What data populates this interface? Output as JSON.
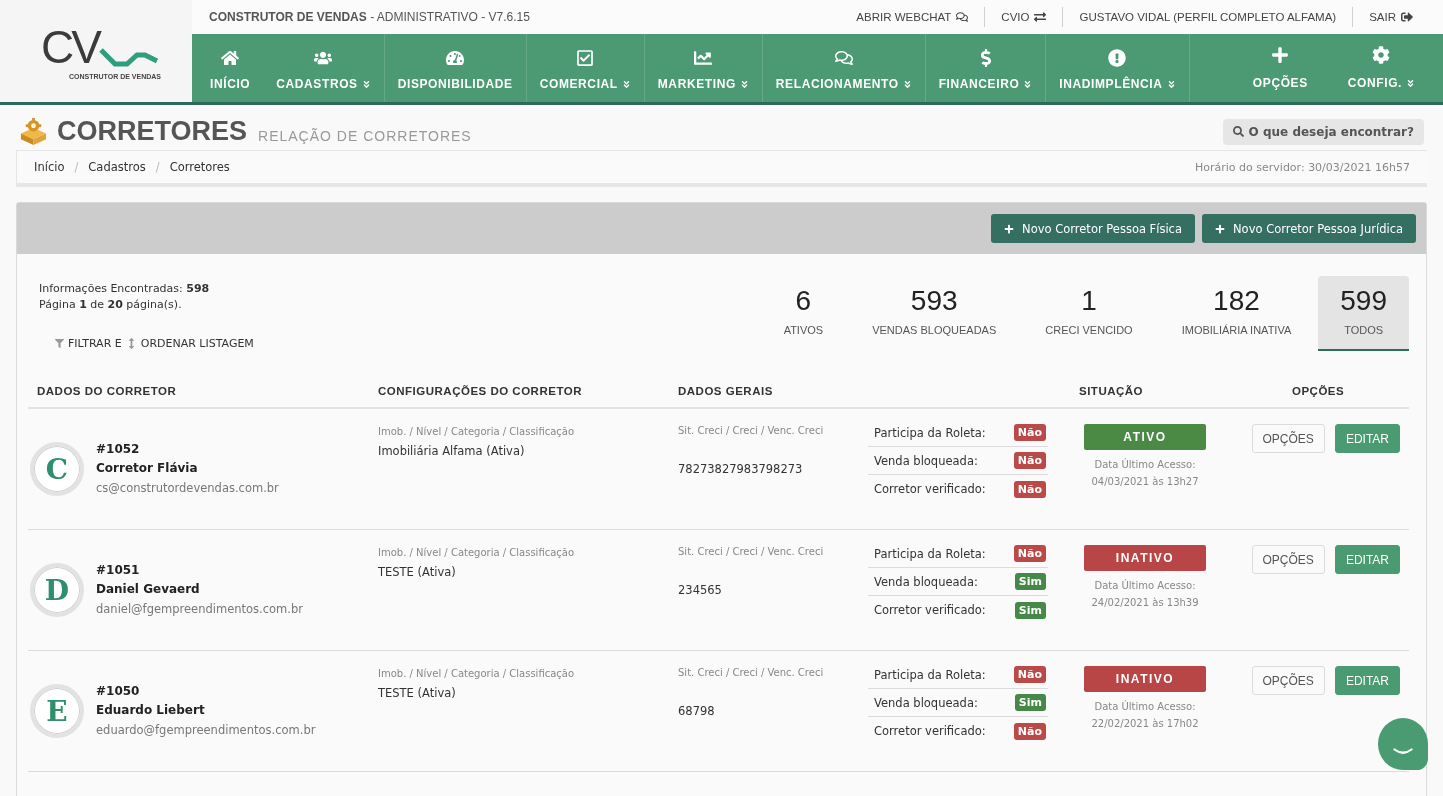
{
  "header": {
    "logo": {
      "letters": "CV",
      "caption": "CONSTRUTOR DE VENDAS"
    },
    "app_title": "**CONSTRUTOR DE VENDAS** - ADMINISTRATIVO - V7.6.15",
    "top_links": [
      "ABRIR WEBCHAT",
      "CVIO",
      "GUSTAVO VIDAL (PERFIL COMPLETO ALFAMA)",
      "SAIR"
    ]
  },
  "nav": {
    "items": [
      {
        "label": "INÍCIO",
        "has_menu": false
      },
      {
        "label": "CADASTROS",
        "has_menu": true
      },
      {
        "label": "DISPONIBILIDADE",
        "has_menu": false
      },
      {
        "label": "COMERCIAL",
        "has_menu": true
      },
      {
        "label": "MARKETING",
        "has_menu": true
      },
      {
        "label": "RELACIONAMENTO",
        "has_menu": true
      },
      {
        "label": "FINANCEIRO",
        "has_menu": true
      },
      {
        "label": "INADIMPLÊNCIA",
        "has_menu": true
      }
    ],
    "right_items": [
      {
        "label": "OPÇÕES",
        "has_menu": false
      },
      {
        "label": "CONFIG.",
        "has_menu": true
      }
    ]
  },
  "page": {
    "title": "CORRETORES",
    "subtitle": "RELAÇÃO DE CORRETORES",
    "search_button": "O que deseja encontrar?"
  },
  "breadcrumb": {
    "items": [
      "Início",
      "Cadastros",
      "Corretores"
    ],
    "separator": "/",
    "server_time": "Horário do servidor: 30/03/2021 16h57"
  },
  "panel": {
    "buttons": [
      "Novo Corretor Pessoa Física",
      "Novo Corretor Pessoa Jurídica"
    ],
    "info": [
      "Informações Encontradas: **598**",
      "Página **1** de **20** página(s)."
    ],
    "filter": {
      "filter_label": "FILTRAR E",
      "sort_label": "ORDENAR LISTAGEM"
    }
  },
  "stats": [
    {
      "value": "6",
      "label": "ATIVOS",
      "selected": false
    },
    {
      "value": "593",
      "label": "VENDAS BLOQUEADAS",
      "selected": false
    },
    {
      "value": "1",
      "label": "CRECI VENCIDO",
      "selected": false
    },
    {
      "value": "182",
      "label": "IMOBILIÁRIA INATIVA",
      "selected": false
    },
    {
      "value": "599",
      "label": "TODOS",
      "selected": true
    }
  ],
  "table": {
    "columns": [
      "DADOS DO CORRETOR",
      "CONFIGURAÇÕES DO CORRETOR",
      "DADOS GERAIS",
      "SITUAÇÃO",
      "OPÇÕES"
    ],
    "rows": [
      {
        "initial": "C",
        "id": "#1052",
        "name": "Corretor Flávia",
        "email": "cs@construtordevendas.com.br",
        "config_label": "Imob. / Nível / Categoria / Classificação",
        "config_value": "Imobiliária Alfama (Ativa)",
        "general_label": "Sit. Creci / Creci / Venc. Creci",
        "general_value": "78273827983798273",
        "flags": [
          {
            "label": "Participa da Roleta:",
            "value": "Não",
            "on": false
          },
          {
            "label": "Venda bloqueada:",
            "value": "Não",
            "on": false
          },
          {
            "label": "Corretor verificado:",
            "value": "Não",
            "on": false
          }
        ],
        "status": {
          "label": "ATIVO",
          "active": true
        },
        "last_access_label": "Data Último Acesso:",
        "last_access": "04/03/2021 às 13h27",
        "buttons": [
          {
            "label": "OPÇÕES",
            "kind": "default"
          },
          {
            "label": "EDITAR",
            "kind": "primary"
          }
        ]
      },
      {
        "initial": "D",
        "id": "#1051",
        "name": "Daniel Gevaerd",
        "email": "daniel@fgempreendimentos.com.br",
        "config_label": "Imob. / Nível / Categoria / Classificação",
        "config_value": "TESTE (Ativa)",
        "general_label": "Sit. Creci / Creci / Venc. Creci",
        "general_value": "234565",
        "flags": [
          {
            "label": "Participa da Roleta:",
            "value": "Não",
            "on": false
          },
          {
            "label": "Venda bloqueada:",
            "value": "Sim",
            "on": true
          },
          {
            "label": "Corretor verificado:",
            "value": "Sim",
            "on": true
          }
        ],
        "status": {
          "label": "INATIVO",
          "active": false
        },
        "last_access_label": "Data Último Acesso:",
        "last_access": "24/02/2021 às 13h39",
        "buttons": [
          {
            "label": "OPÇÕES",
            "kind": "default"
          },
          {
            "label": "EDITAR",
            "kind": "primary"
          }
        ]
      },
      {
        "initial": "E",
        "id": "#1050",
        "name": "Eduardo Liebert",
        "email": "eduardo@fgempreendimentos.com.br",
        "config_label": "Imob. / Nível / Categoria / Classificação",
        "config_value": "TESTE (Ativa)",
        "general_label": "Sit. Creci / Creci / Venc. Creci",
        "general_value": "68798",
        "flags": [
          {
            "label": "Participa da Roleta:",
            "value": "Não",
            "on": false
          },
          {
            "label": "Venda bloqueada:",
            "value": "Sim",
            "on": true
          },
          {
            "label": "Corretor verificado:",
            "value": "Não",
            "on": false
          }
        ],
        "status": {
          "label": "INATIVO",
          "active": false
        },
        "last_access_label": "Data Último Acesso:",
        "last_access": "22/02/2021 às 17h02",
        "buttons": [
          {
            "label": "OPÇÕES",
            "kind": "default"
          },
          {
            "label": "EDITAR",
            "kind": "primary"
          }
        ]
      }
    ]
  }
}
